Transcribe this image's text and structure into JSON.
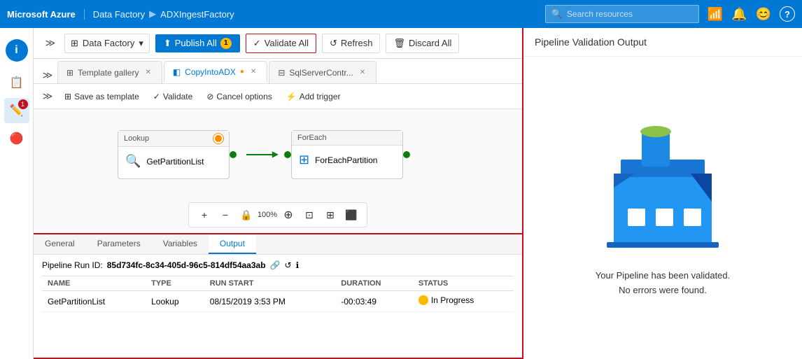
{
  "topnav": {
    "brand": "Microsoft Azure",
    "breadcrumb": [
      "Data Factory",
      "▶",
      "ADXIngestFactory"
    ],
    "search_placeholder": "Search resources",
    "icons": [
      "📶",
      "🔔",
      "😊",
      "?"
    ]
  },
  "sidebar": {
    "icons": [
      "📋",
      "✏️",
      "🔴"
    ]
  },
  "toolbar": {
    "df_label": "Data Factory",
    "publish_label": "Publish All",
    "publish_badge": "1",
    "validate_all_label": "Validate All",
    "refresh_label": "Refresh",
    "discard_label": "Discard All"
  },
  "tabs": [
    {
      "id": "template-gallery",
      "label": "Template gallery",
      "icon": "⊞",
      "closable": true,
      "active": false
    },
    {
      "id": "copy-into-adx",
      "label": "CopyIntoADX",
      "icon": "◧",
      "closable": true,
      "active": true
    },
    {
      "id": "sql-server-contr",
      "label": "SqlServerContr...",
      "icon": "⊟",
      "closable": true,
      "active": false
    }
  ],
  "subtoolbar": {
    "save_template": "Save as template",
    "validate": "Validate",
    "cancel_options": "Cancel options",
    "add_trigger": "Add trigger"
  },
  "pipeline": {
    "lookup_node": {
      "header": "Lookup",
      "label": "GetPartitionList",
      "icon": "🔍"
    },
    "foreach_node": {
      "header": "ForEach",
      "label": "ForEachPartition",
      "icon": "⊞"
    }
  },
  "output_panel": {
    "tabs": [
      "General",
      "Parameters",
      "Variables",
      "Output"
    ],
    "active_tab": "Output",
    "pipeline_run_label": "Pipeline Run ID:",
    "pipeline_run_id": "85d734fc-8c34-405d-96c5-814df54aa3ab",
    "table": {
      "headers": [
        "NAME",
        "TYPE",
        "RUN START",
        "DURATION",
        "STATUS"
      ],
      "rows": [
        {
          "name": "GetPartitionList",
          "type": "Lookup",
          "run_start": "08/15/2019 3:53 PM",
          "duration": "-00:03:49",
          "status": "In Progress"
        }
      ]
    }
  },
  "validation_panel": {
    "title": "Pipeline Validation Output",
    "message_line1": "Your Pipeline has been validated.",
    "message_line2": "No errors were found."
  },
  "canvas_tools": [
    "+",
    "−",
    "🔒",
    "100%",
    "⊕",
    "⊡",
    "⊞",
    "⬛"
  ]
}
